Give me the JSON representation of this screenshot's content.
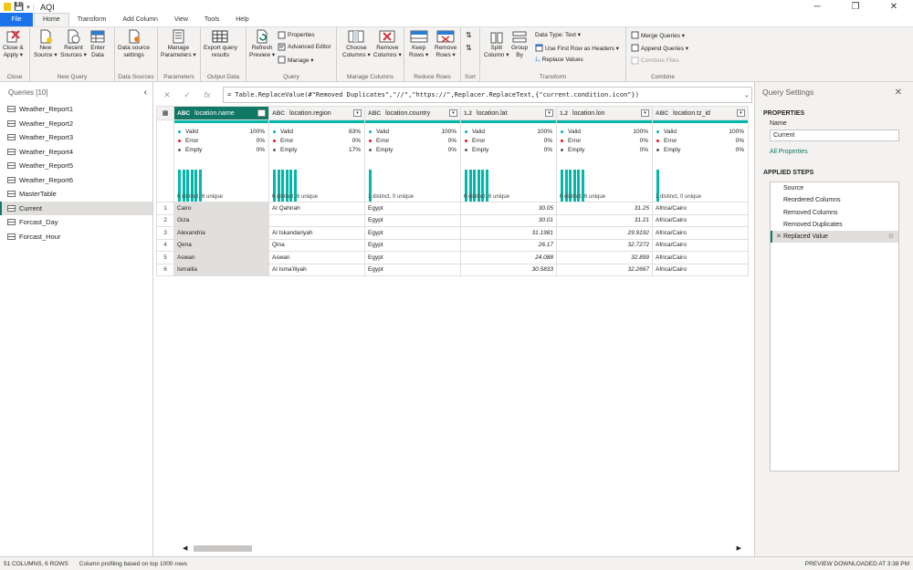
{
  "window": {
    "title": "AQI"
  },
  "tabs": [
    "File",
    "Home",
    "Transform",
    "Add Column",
    "View",
    "Tools",
    "Help"
  ],
  "ribbon": {
    "close_apply": "Close &",
    "close_apply2": "Apply ▾",
    "new_source": "New",
    "new_source2": "Source ▾",
    "recent_sources": "Recent",
    "recent_sources2": "Sources ▾",
    "enter_data": "Enter",
    "enter_data2": "Data",
    "ds_settings": "Data source",
    "ds_settings2": "settings",
    "manage_params": "Manage",
    "manage_params2": "Parameters ▾",
    "export_query": "Export query",
    "export_query2": "results",
    "refresh": "Refresh",
    "refresh2": "Preview ▾",
    "properties": "Properties",
    "advanced_editor": "Advanced Editor",
    "manage": "Manage ▾",
    "choose_cols": "Choose",
    "choose_cols2": "Columns ▾",
    "remove_cols": "Remove",
    "remove_cols2": "Columns ▾",
    "keep_rows": "Keep",
    "keep_rows2": "Rows ▾",
    "remove_rows": "Remove",
    "remove_rows2": "Rows ▾",
    "split_col": "Split",
    "split_col2": "Column ▾",
    "group_by": "Group",
    "group_by2": "By",
    "data_type": "Data Type: Text ▾",
    "first_row": "Use First Row as Headers ▾",
    "replace_values": "Replace Values",
    "merge_queries": "Merge Queries ▾",
    "append_queries": "Append Queries ▾",
    "combine_files": "Combine Files",
    "groups": {
      "close": "Close",
      "new_query": "New Query",
      "data_sources": "Data Sources",
      "parameters": "Parameters",
      "output_data": "Output Data",
      "query": "Query",
      "manage_columns": "Manage Columns",
      "reduce_rows": "Reduce Rows",
      "sort": "Sort",
      "transform": "Transform",
      "combine": "Combine"
    }
  },
  "queries": {
    "header": "Queries [10]",
    "items": [
      "Weather_Report1",
      "Weather_Report2",
      "Weather_Report3",
      "Weather_Report4",
      "Weather_Report5",
      "Weather_Report6",
      "MasterTable",
      "Current",
      "Forcast_Day",
      "Forcast_Hour"
    ],
    "selected_index": 7
  },
  "formula": {
    "fx": "fx",
    "text": "= Table.ReplaceValue(#\"Removed Duplicates\",\"//\",\"https://\",Replacer.ReplaceText,{\"current.condition.icon\"})"
  },
  "columns": [
    {
      "type": "ABC",
      "name": "location.name",
      "valid": "100%",
      "error": "0%",
      "empty": "0%",
      "bars": 6,
      "distinct": "6 distinct, 6 unique"
    },
    {
      "type": "ABC",
      "name": "location.region",
      "valid": "83%",
      "error": "0%",
      "empty": "17%",
      "bars": 6,
      "distinct": "6 distinct, 6 unique"
    },
    {
      "type": "ABC",
      "name": "location.country",
      "valid": "100%",
      "error": "0%",
      "empty": "0%",
      "bars": 1,
      "distinct": "1 distinct, 0 unique"
    },
    {
      "type": "1.2",
      "name": "location.lat",
      "valid": "100%",
      "error": "0%",
      "empty": "0%",
      "bars": 6,
      "distinct": "6 distinct, 6 unique"
    },
    {
      "type": "1.2",
      "name": "location.lon",
      "valid": "100%",
      "error": "0%",
      "empty": "0%",
      "bars": 6,
      "distinct": "6 distinct, 6 unique"
    },
    {
      "type": "ABC",
      "name": "location.tz_id",
      "valid": "100%",
      "error": "0%",
      "empty": "0%",
      "bars": 1,
      "distinct": "1 distinct, 0 unique"
    }
  ],
  "profile_labels": {
    "valid": "Valid",
    "error": "Error",
    "empty": "Empty"
  },
  "rows": [
    [
      "1",
      "Cairo",
      "Al Qahirah",
      "Egypt",
      "30.05",
      "31.25",
      "Africa/Cairo"
    ],
    [
      "2",
      "Giza",
      "",
      "Egypt",
      "30.01",
      "31.21",
      "Africa/Cairo"
    ],
    [
      "3",
      "Alexandria",
      "Al Iskandariyah",
      "Egypt",
      "31.1981",
      "29.9192",
      "Africa/Cairo"
    ],
    [
      "4",
      "Qena",
      "Qina",
      "Egypt",
      "26.17",
      "32.7272",
      "Africa/Cairo"
    ],
    [
      "5",
      "Aswan",
      "Aswan",
      "Egypt",
      "24.088",
      "32.899",
      "Africa/Cairo"
    ],
    [
      "6",
      "Ismailia",
      "Al Isma'iliyah",
      "Egypt",
      "30.5833",
      "32.2667",
      "Africa/Cairo"
    ]
  ],
  "settings": {
    "title": "Query Settings",
    "properties": "PROPERTIES",
    "name_label": "Name",
    "name_value": "Current",
    "all_properties": "All Properties",
    "applied_steps": "APPLIED STEPS",
    "steps": [
      "Source",
      "Reordered Columns",
      "Removed Columns",
      "Removed Duplicates",
      "Replaced Value"
    ]
  },
  "status": {
    "columns_rows": "51 COLUMNS, 6 ROWS",
    "profiling": "Column profiling based on top 1000 rows",
    "preview": "PREVIEW DOWNLOADED AT 3:38 PM"
  },
  "colors": {
    "accent": "#117865",
    "profile_bar": "#01b8aa",
    "valid": "#01b8aa",
    "error": "#e81123",
    "empty": "#605e5c"
  }
}
